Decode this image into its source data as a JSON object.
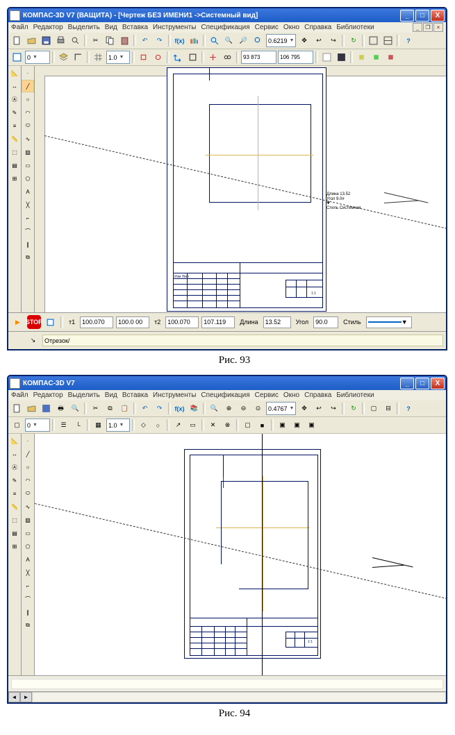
{
  "fig93": {
    "title": "КОМПАС-3D V7 (ВАЩИТА) - [Чертеж БЕЗ ИМЕНИ1 ->Системный вид]",
    "menus": [
      "Файл",
      "Редактор",
      "Выделить",
      "Вид",
      "Вставка",
      "Инструменты",
      "Спецификация",
      "Сервис",
      "Окно",
      "Справка",
      "Библиотеки"
    ],
    "zoom": "0.6219",
    "layer": "0",
    "tbdim": "1.0",
    "ann_len": "Длина 13.52",
    "ann_ang": "Угол 9.0#",
    "ann_style": "Стиль Системная",
    "status": {
      "x": "100.070",
      "y": "100.0 00",
      "x2": "100.070",
      "y2": "107.119",
      "len_lbl": "Длина",
      "len": "13.52",
      "ang_lbl": "Угол",
      "ang": "90.0",
      "style_lbl": "Стиль"
    },
    "cmdline": "Отрезок/",
    "caption": "Рис. 93"
  },
  "fig94": {
    "title": "КОМПАС-3D V7",
    "menus": [
      "Файл",
      "Редактор",
      "Выделить",
      "Вид",
      "Вставка",
      "Инструменты",
      "Спецификация",
      "Сервис",
      "Окно",
      "Справка",
      "Библиотеки"
    ],
    "zoom": "0.4767",
    "layer": "0",
    "tbdim": "1.0",
    "caption": "Рис. 94"
  }
}
